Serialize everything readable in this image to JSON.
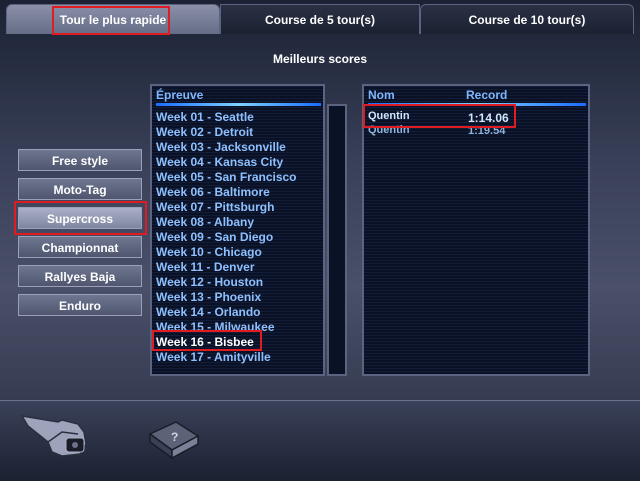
{
  "tabs": [
    {
      "label": "Tour le plus rapide",
      "active": true
    },
    {
      "label": "Course de 5 tour(s)",
      "active": false
    },
    {
      "label": "Course de 10 tour(s)",
      "active": false
    }
  ],
  "section_title": "Meilleurs scores",
  "modes": [
    {
      "label": "Free style"
    },
    {
      "label": "Moto-Tag"
    },
    {
      "label": "Supercross",
      "selected": true
    },
    {
      "label": "Championnat"
    },
    {
      "label": "Rallyes Baja"
    },
    {
      "label": "Enduro"
    }
  ],
  "events": {
    "header": "Épreuve",
    "items": [
      "Week 01 - Seattle",
      "Week 02 - Detroit",
      "Week 03 - Jacksonville",
      "Week 04 - Kansas City",
      "Week 05 - San Francisco",
      "Week 06 - Baltimore",
      "Week 07 - Pittsburgh",
      "Week 08 - Albany",
      "Week 09 - San Diego",
      "Week 10 - Chicago",
      "Week 11 - Denver",
      "Week 12 - Houston",
      "Week 13 - Phoenix",
      "Week 14 - Orlando",
      "Week 15 - Milwaukee",
      "Week 16 - Bisbee",
      "Week 17 - Amityville"
    ],
    "selected_index": 15
  },
  "scores": {
    "header_name": "Nom",
    "header_record": "Record",
    "rows": [
      {
        "name": "Quentin",
        "record": "1:14.06"
      },
      {
        "name": "Quentin",
        "record": "1:19.54"
      }
    ]
  },
  "bottom_icons": [
    "hand-pointer-icon",
    "help-book-icon"
  ],
  "colors": {
    "highlight": "#e11b22",
    "list_text": "#8ec0ff",
    "accent_line": "#1a6cff"
  }
}
